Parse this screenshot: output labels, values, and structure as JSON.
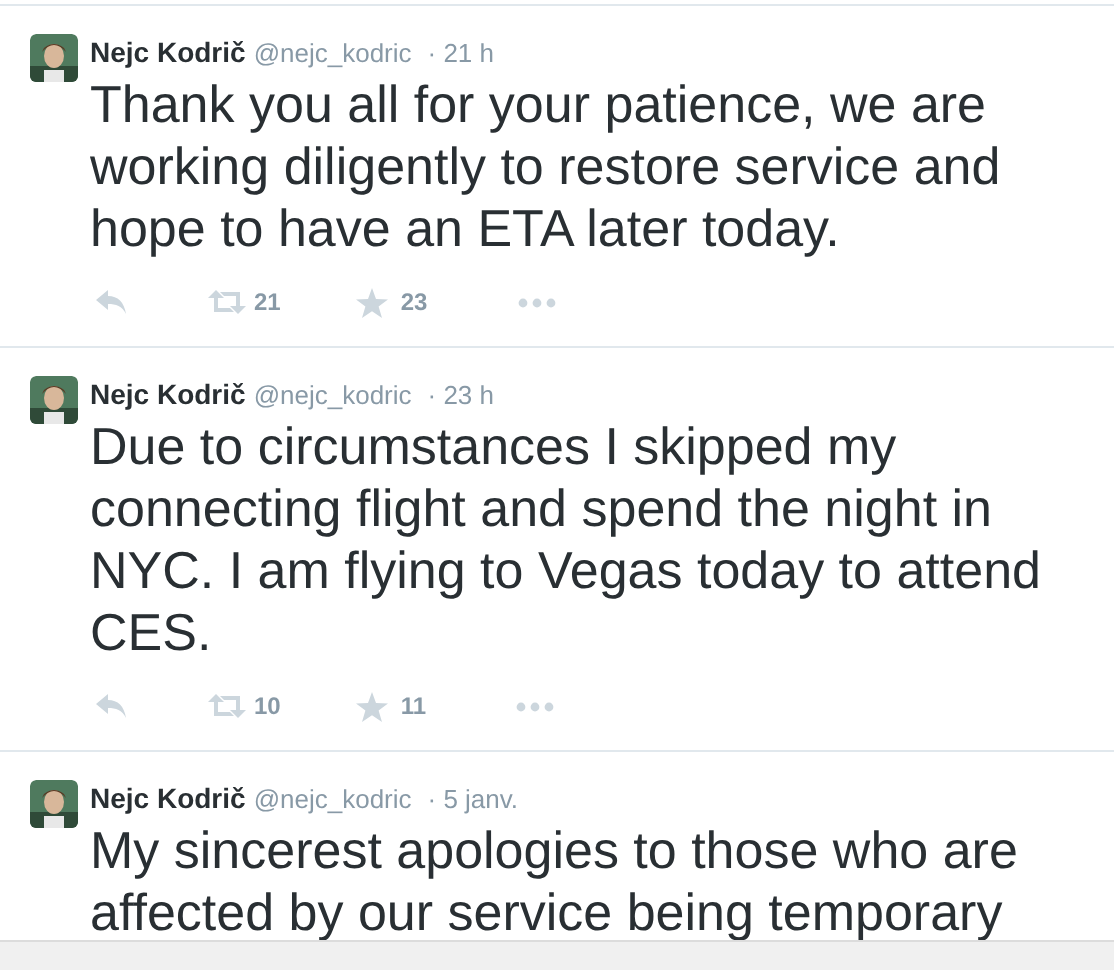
{
  "tweets": [
    {
      "name": "Nejc Kodrič",
      "handle": "@nejc_kodric",
      "time": "· 21 h",
      "text": "Thank you all for your patience, we are working diligently to restore service and hope to have an ETA later today.",
      "retweets": "21",
      "favorites": "23"
    },
    {
      "name": "Nejc Kodrič",
      "handle": "@nejc_kodric",
      "time": "· 23 h",
      "text": "Due to circumstances I skipped my connecting flight and spend the night in NYC. I am flying to Vegas today to attend CES.",
      "retweets": "10",
      "favorites": "11"
    },
    {
      "name": "Nejc Kodrič",
      "handle": "@nejc_kodric",
      "time": "· 5 janv.",
      "text": "My sincerest apologies to those who are affected by our service being temporary"
    }
  ]
}
